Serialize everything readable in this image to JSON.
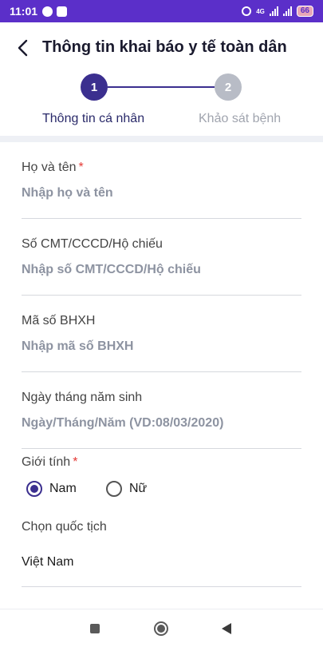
{
  "status_bar": {
    "time": "11:01",
    "network": "4G",
    "battery": "66",
    "background_color": "#5b2fc9"
  },
  "header": {
    "title": "Thông tin khai báo y tế toàn dân",
    "back_icon": "chevron-left-icon"
  },
  "stepper": {
    "steps": [
      {
        "number": "1",
        "label": "Thông tin cá nhân",
        "active": true
      },
      {
        "number": "2",
        "label": "Khảo sát bệnh",
        "active": false
      }
    ],
    "active_color": "#3b2f8f",
    "inactive_color": "#b8bcc6"
  },
  "form": {
    "full_name": {
      "label": "Họ và tên",
      "required": "*",
      "placeholder": "Nhập họ và tên",
      "value": ""
    },
    "id_number": {
      "label": "Số CMT/CCCD/Hộ chiếu",
      "placeholder": "Nhập số CMT/CCCD/Hộ chiếu",
      "value": ""
    },
    "insurance": {
      "label": "Mã số BHXH",
      "placeholder": "Nhập mã số BHXH",
      "value": ""
    },
    "birth_date": {
      "label": "Ngày tháng năm sinh",
      "placeholder": "Ngày/Tháng/Năm (VD:08/03/2020)",
      "value": ""
    },
    "gender": {
      "label": "Giới tính",
      "required": "*",
      "options": [
        "Nam",
        "Nữ"
      ],
      "selected": "Nam"
    },
    "nationality": {
      "label": "Chọn quốc tịch",
      "value": "Việt Nam"
    }
  },
  "nav_bar": {
    "icons": [
      "recents-icon",
      "home-icon",
      "back-triangle-icon"
    ]
  }
}
